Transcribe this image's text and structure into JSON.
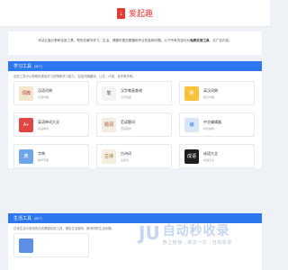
{
  "header": {
    "logo_glyph": "↓",
    "title": "爱起趣"
  },
  "intro": {
    "text": "本站云盘分享和实用工具，帮你在解决学习、生活、健康时更加便捷和专业的各种问题。以下所有内容均为",
    "highlight": "免费实用工具",
    "suffix": "，无广告内容。"
  },
  "sections": [
    {
      "title": "学习工具",
      "count": "(96个)",
      "description": "这些工具可以帮助你提高学习效率和学习能力，包括词典翻译、公式、计算、写作等多种。",
      "tools": [
        {
          "name": "汉语词典",
          "sub": "汉语词典",
          "icon_text": "词典",
          "icon_color": "#f3e6cf",
          "icon_fg": "#b8362b"
        },
        {
          "name": "汉字笔画查询",
          "sub": "汉字笔画",
          "icon_text": "笔",
          "icon_color": "#f3f3f3",
          "icon_fg": "#555555"
        },
        {
          "name": "英汉词典",
          "sub": "英汉词典",
          "icon_text": "英",
          "icon_color": "#f6c33b",
          "icon_fg": "#ffffff"
        },
        {
          "name": "英语单词大全",
          "sub": "英语单词",
          "icon_text": "A+",
          "icon_color": "#e04646",
          "icon_fg": "#ffffff"
        },
        {
          "name": "范读题词",
          "sub": "范读题词",
          "icon_text": "题词",
          "icon_color": "#f3ede1",
          "icon_fg": "#a64b2a"
        },
        {
          "name": "中文编辑器",
          "sub": "中文编辑",
          "icon_text": "编",
          "icon_color": "#d9e6f8",
          "icon_fg": "#2e77ee"
        },
        {
          "name": "字典",
          "sub": "新华字典",
          "icon_text": "典",
          "icon_color": "#6ea5e8",
          "icon_fg": "#ffffff"
        },
        {
          "name": "古诗词",
          "sub": "古诗词",
          "icon_text": "古诗",
          "icon_color": "#f5efe0",
          "icon_fg": "#8a6d2c"
        },
        {
          "name": "成语大全",
          "sub": "成语大全",
          "icon_text": "成语",
          "icon_color": "#1f1f1f",
          "icon_fg": "#ffffff"
        }
      ]
    },
    {
      "title": "生活工具",
      "count": "(85个)",
      "description": "日常生活中常用的在线便捷实用工具，便民生活服务，解决你的生活问题。",
      "tools": [
        {
          "name": "",
          "sub": "",
          "icon_text": "",
          "icon_color": "#5d8fe6",
          "icon_fg": "#ffffff"
        }
      ]
    }
  ],
  "watermark": {
    "logo": "JU",
    "title": "自动秒收录",
    "sub": "数上链接→来访一次→自动收录"
  }
}
